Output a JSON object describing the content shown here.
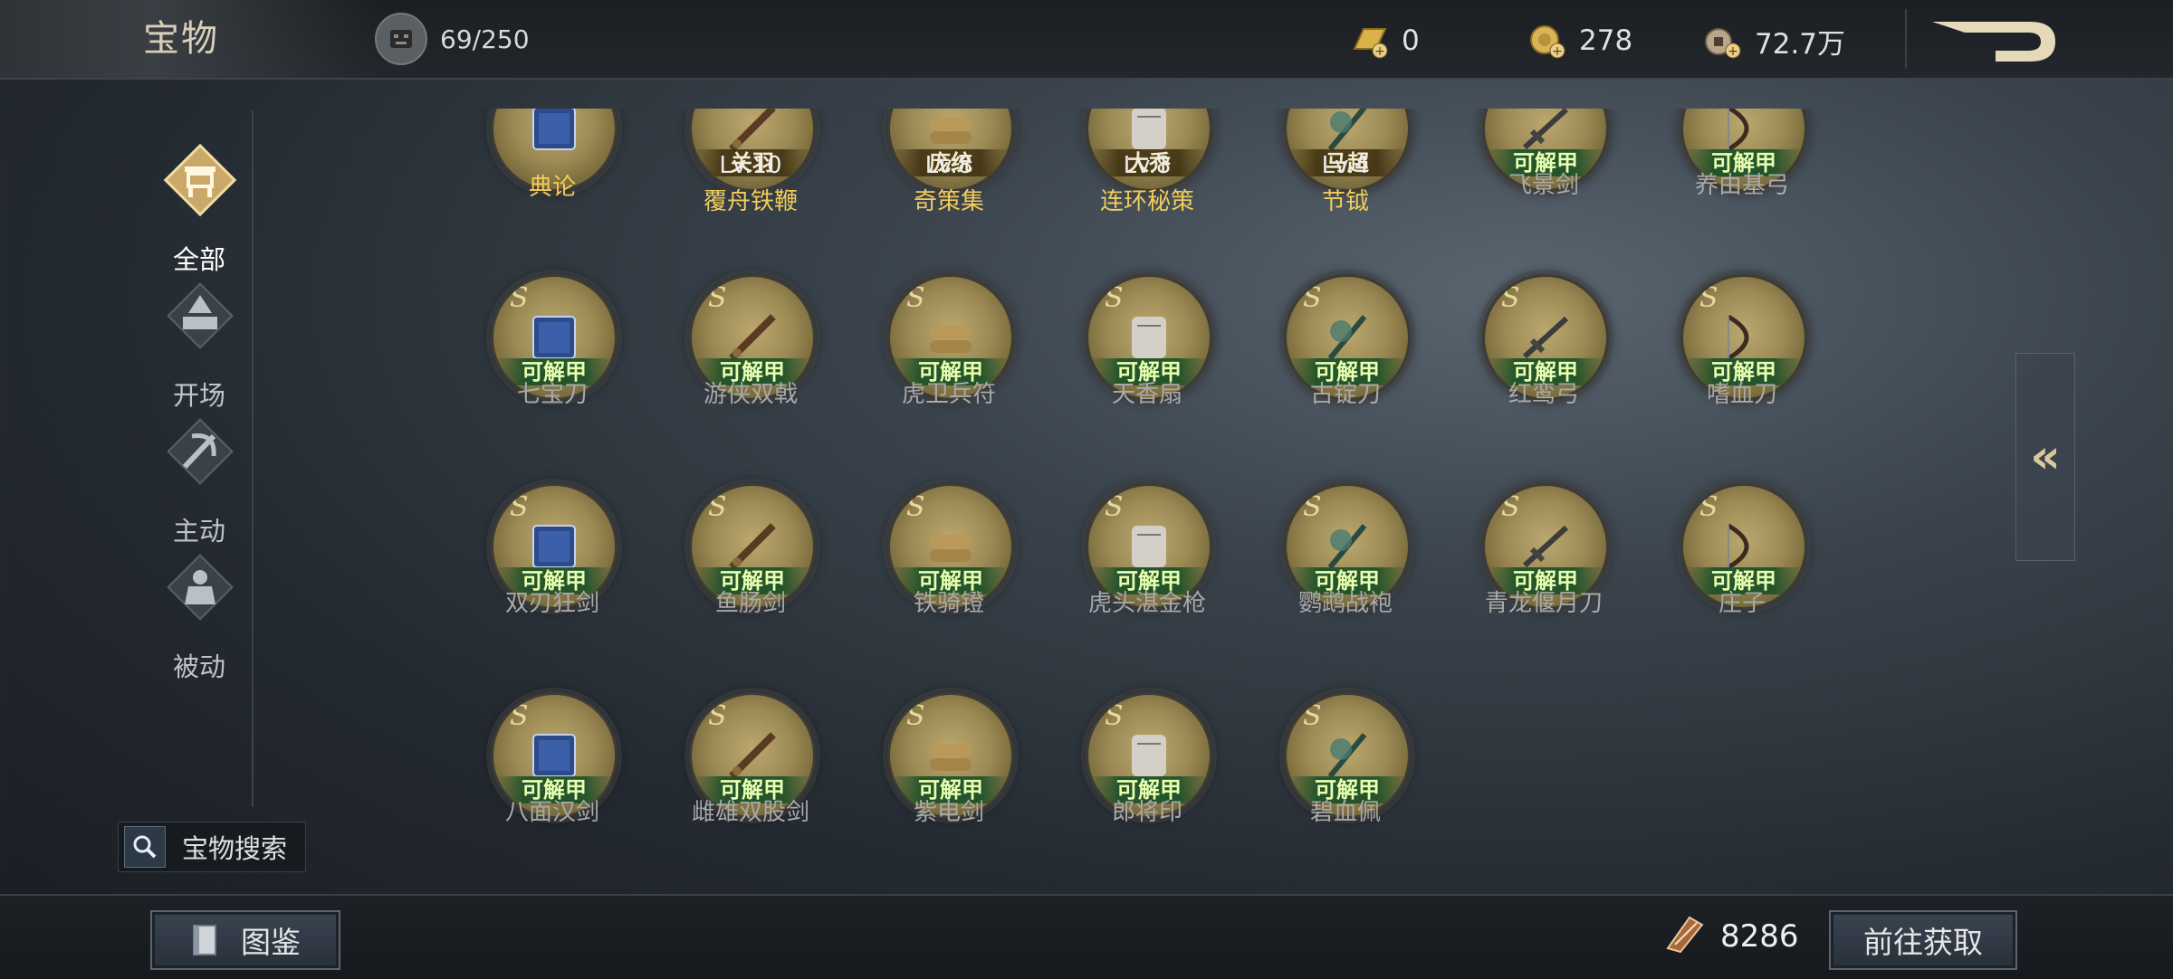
{
  "header": {
    "title": "宝物",
    "capacity": "69/250",
    "currencies": [
      {
        "icon": "gold-bar-icon",
        "value": "0"
      },
      {
        "icon": "gold-coin-icon",
        "value": "278"
      },
      {
        "icon": "copper-coin-icon",
        "value": "72.7万"
      }
    ],
    "back_icon": "return-arrow-icon"
  },
  "sidebar": {
    "items": [
      {
        "label": "全部",
        "icon": "all-treasure-icon",
        "selected": true
      },
      {
        "label": "开场",
        "icon": "opening-icon",
        "selected": false
      },
      {
        "label": "主动",
        "icon": "active-skill-icon",
        "selected": false
      },
      {
        "label": "被动",
        "icon": "passive-skill-icon",
        "selected": false
      }
    ]
  },
  "search": {
    "label": "宝物搜索",
    "icon": "search-icon"
  },
  "colors": {
    "owned_name": "#f2cc5a",
    "unlock_badge": "#e8ffb0",
    "accent_gold": "#d9c99a"
  },
  "treasures": [
    {
      "name": "典论",
      "owned": true,
      "hero": "",
      "level": "",
      "badge": ""
    },
    {
      "name": "覆舟铁鞭",
      "owned": true,
      "hero": "关羽",
      "level": "Lv.10",
      "badge": ""
    },
    {
      "name": "奇策集",
      "owned": true,
      "hero": "庞统",
      "level": "Lv.8",
      "badge": ""
    },
    {
      "name": "连环秘策",
      "owned": true,
      "hero": "大乔",
      "level": "Lv.8",
      "badge": ""
    },
    {
      "name": "节钺",
      "owned": true,
      "hero": "马超",
      "level": "Lv.4",
      "badge": ""
    },
    {
      "name": "飞景剑",
      "owned": false,
      "badge": "可解甲"
    },
    {
      "name": "养由基弓",
      "owned": false,
      "badge": "可解甲"
    },
    {
      "name": "七宝刀",
      "owned": false,
      "badge": "可解甲"
    },
    {
      "name": "游侠双戟",
      "owned": false,
      "badge": "可解甲"
    },
    {
      "name": "虎卫兵符",
      "owned": false,
      "badge": "可解甲"
    },
    {
      "name": "天香扇",
      "owned": false,
      "badge": "可解甲"
    },
    {
      "name": "古锭刀",
      "owned": false,
      "badge": "可解甲"
    },
    {
      "name": "红鸾弓",
      "owned": false,
      "badge": "可解甲"
    },
    {
      "name": "嗜血刀",
      "owned": false,
      "badge": "可解甲"
    },
    {
      "name": "双刃狂剑",
      "owned": false,
      "badge": "可解甲"
    },
    {
      "name": "鱼肠剑",
      "owned": false,
      "badge": "可解甲"
    },
    {
      "name": "铁骑镫",
      "owned": false,
      "badge": "可解甲"
    },
    {
      "name": "虎头湛金枪",
      "owned": false,
      "badge": "可解甲"
    },
    {
      "name": "鹦鹉战袍",
      "owned": false,
      "badge": "可解甲"
    },
    {
      "name": "青龙偃月刀",
      "owned": false,
      "badge": "可解甲"
    },
    {
      "name": "庄子",
      "owned": false,
      "badge": "可解甲"
    },
    {
      "name": "八面汉剑",
      "owned": false,
      "badge": "可解甲"
    },
    {
      "name": "雌雄双股剑",
      "owned": false,
      "badge": "可解甲"
    },
    {
      "name": "紫电剑",
      "owned": false,
      "badge": "可解甲"
    },
    {
      "name": "郎将印",
      "owned": false,
      "badge": "可解甲"
    },
    {
      "name": "碧血佩",
      "owned": false,
      "badge": "可解甲"
    }
  ],
  "footer": {
    "codex_label": "图鉴",
    "points": "8286",
    "points_icon": "fragment-icon",
    "go_label": "前往获取"
  }
}
